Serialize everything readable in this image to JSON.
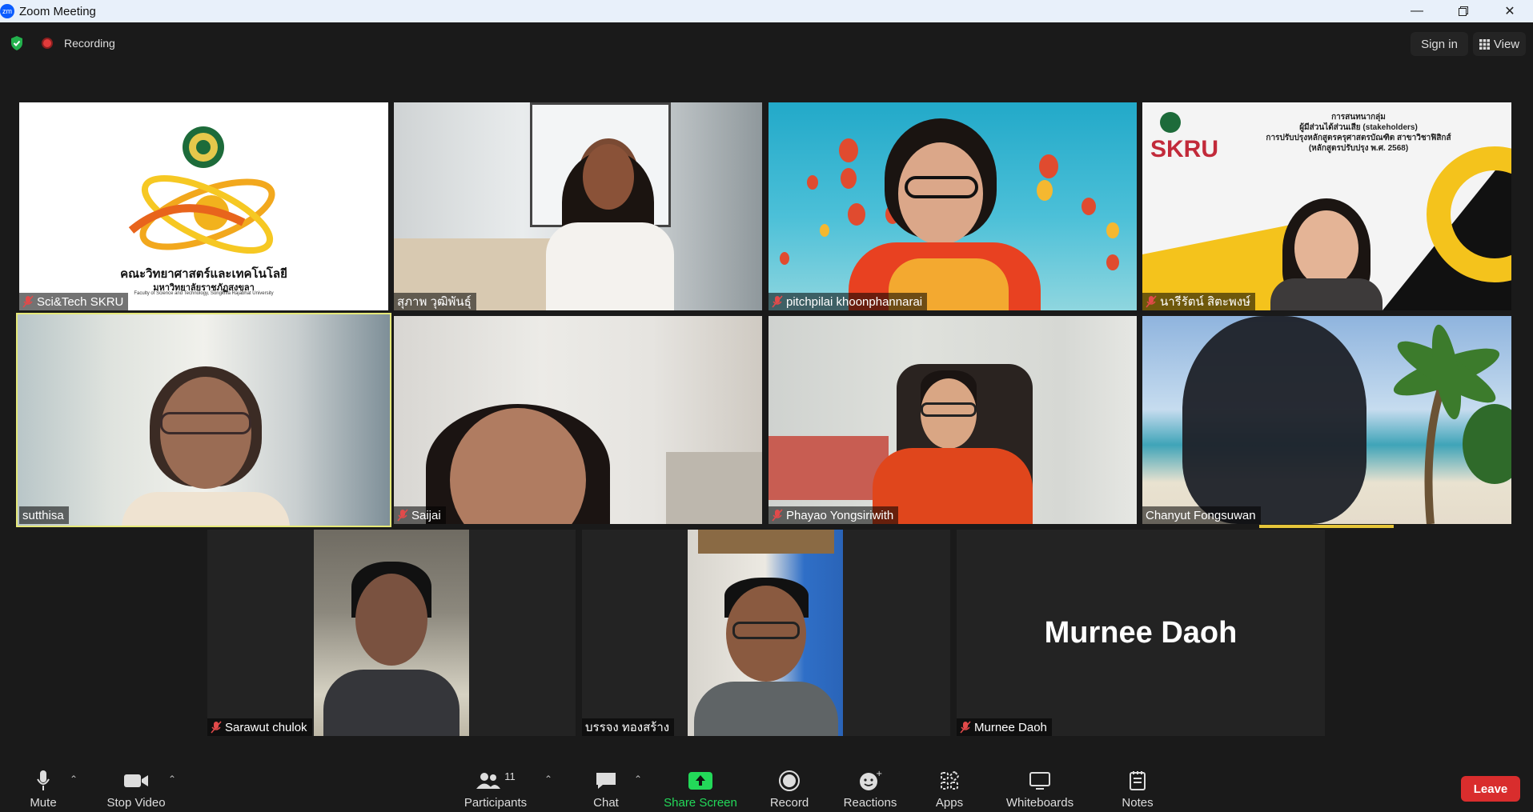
{
  "window": {
    "title": "Zoom Meeting",
    "logo_text": "zm"
  },
  "topbar": {
    "recording_label": "Recording",
    "sign_in_label": "Sign in",
    "view_label": "View"
  },
  "tiles": [
    {
      "name": "Sci&Tech SKRU",
      "muted": true,
      "logo_line1": "คณะวิทยาศาสตร์และเทคโนโลยี",
      "logo_line2": "มหาวิทยาลัยราชภัฏสงขลา",
      "logo_line3": "Faculty of Science and Technology, Songkhla Rajabhat University"
    },
    {
      "name": "สุภาพ วุฒิพันธุ์",
      "muted": false
    },
    {
      "name": "pitchpilai khoonphannarai",
      "muted": true
    },
    {
      "name": "นารีรัตน์ สิตะพงษ์",
      "muted": true,
      "slide_line1": "การสนทนากลุ่ม",
      "slide_line2": "ผู้มีส่วนได้ส่วนเสีย (stakeholders)",
      "slide_line3": "การปรับปรุงหลักสูตรครุศาสตรบัณฑิต สาขาวิชาฟิสิกส์",
      "slide_line4": "(หลักสูตรปรับปรุง พ.ศ. 2568)",
      "slide_brand": "SKRU"
    },
    {
      "name": "sutthisa",
      "muted": false,
      "active": true
    },
    {
      "name": "Saijai",
      "muted": true
    },
    {
      "name": "Phayao Yongsiriwith",
      "muted": true
    },
    {
      "name": "Chanyut Fongsuwan",
      "muted": false
    },
    {
      "name": "Sarawut chulok",
      "muted": true
    },
    {
      "name": "บรรจง ทองสร้าง",
      "muted": false
    },
    {
      "name": "Murnee Daoh",
      "muted": true,
      "big_name": "Murnee Daoh"
    }
  ],
  "toolbar": {
    "mute_label": "Mute",
    "video_label": "Stop Video",
    "participants_label": "Participants",
    "participants_count": "11",
    "chat_label": "Chat",
    "share_label": "Share Screen",
    "record_label": "Record",
    "reactions_label": "Reactions",
    "apps_label": "Apps",
    "whiteboards_label": "Whiteboards",
    "notes_label": "Notes",
    "leave_label": "Leave"
  },
  "colors": {
    "share_green": "#23d959",
    "leave_red": "#d92d2d",
    "active_speaker": "#e5e878",
    "mute_red": "#e24a4a"
  }
}
